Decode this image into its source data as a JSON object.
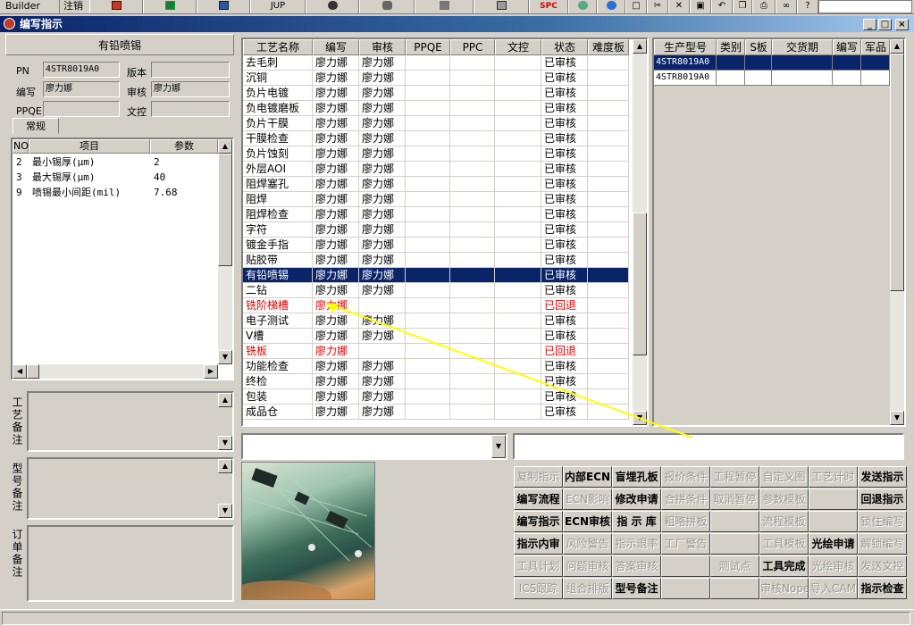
{
  "toolbar": {
    "builder_label": "Builder",
    "logout_label": "注销",
    "jup_label": "JUP",
    "spc_label": "SPC"
  },
  "window": {
    "title": "编写指示"
  },
  "left_panel": {
    "title": "有铅喷锡",
    "pn_label": "PN",
    "pn_value": "4STR8019A0",
    "version_label": "版本",
    "version_value": "",
    "writer_label": "编写",
    "writer_value": "廖力娜",
    "reviewer_label": "审核",
    "reviewer_value": "廖力娜",
    "ppqe_label": "PPQE",
    "ppqe_value": "",
    "doc_control_label": "文控",
    "doc_control_value": "",
    "tab_label": "常规",
    "param_headers": [
      "NO",
      "项目",
      "参数"
    ],
    "params": [
      {
        "no": "2",
        "item": "最小锡厚(μm)",
        "value": "2"
      },
      {
        "no": "3",
        "item": "最大锡厚(μm)",
        "value": "40"
      },
      {
        "no": "9",
        "item": "喷锡最小间距(mil)",
        "value": "7.68"
      }
    ]
  },
  "remarks": {
    "process_remark_label": "工艺备注",
    "model_remark_label": "型号备注",
    "order_remark_label": "订单备注"
  },
  "process_grid": {
    "headers": [
      "工艺名称",
      "编写",
      "审核",
      "PPQE",
      "PPC",
      "文控",
      "状态",
      "难度板"
    ],
    "selected_index": 14,
    "rows": [
      {
        "name": "去毛刺",
        "writer": "廖力娜",
        "reviewer": "廖力娜",
        "status": "已审核",
        "returned": false
      },
      {
        "name": "沉铜",
        "writer": "廖力娜",
        "reviewer": "廖力娜",
        "status": "已审核",
        "returned": false
      },
      {
        "name": "负片电镀",
        "writer": "廖力娜",
        "reviewer": "廖力娜",
        "status": "已审核",
        "returned": false
      },
      {
        "name": "负电镀磨板",
        "writer": "廖力娜",
        "reviewer": "廖力娜",
        "status": "已审核",
        "returned": false
      },
      {
        "name": "负片干膜",
        "writer": "廖力娜",
        "reviewer": "廖力娜",
        "status": "已审核",
        "returned": false
      },
      {
        "name": "干膜检查",
        "writer": "廖力娜",
        "reviewer": "廖力娜",
        "status": "已审核",
        "returned": false
      },
      {
        "name": "负片蚀刻",
        "writer": "廖力娜",
        "reviewer": "廖力娜",
        "status": "已审核",
        "returned": false
      },
      {
        "name": "外层AOI",
        "writer": "廖力娜",
        "reviewer": "廖力娜",
        "status": "已审核",
        "returned": false
      },
      {
        "name": "阻焊塞孔",
        "writer": "廖力娜",
        "reviewer": "廖力娜",
        "status": "已审核",
        "returned": false
      },
      {
        "name": "阻焊",
        "writer": "廖力娜",
        "reviewer": "廖力娜",
        "status": "已审核",
        "returned": false
      },
      {
        "name": "阻焊检查",
        "writer": "廖力娜",
        "reviewer": "廖力娜",
        "status": "已审核",
        "returned": false
      },
      {
        "name": "字符",
        "writer": "廖力娜",
        "reviewer": "廖力娜",
        "status": "已审核",
        "returned": false
      },
      {
        "name": "镀金手指",
        "writer": "廖力娜",
        "reviewer": "廖力娜",
        "status": "已审核",
        "returned": false
      },
      {
        "name": "贴胶带",
        "writer": "廖力娜",
        "reviewer": "廖力娜",
        "status": "已审核",
        "returned": false
      },
      {
        "name": "有铅喷锡",
        "writer": "廖力娜",
        "reviewer": "廖力娜",
        "status": "已审核",
        "returned": false
      },
      {
        "name": "二钻",
        "writer": "廖力娜",
        "reviewer": "廖力娜",
        "status": "已审核",
        "returned": false
      },
      {
        "name": "铣阶梯槽",
        "writer": "廖力娜",
        "reviewer": "",
        "status": "已回退",
        "returned": true
      },
      {
        "name": "电子测试",
        "writer": "廖力娜",
        "reviewer": "廖力娜",
        "status": "已审核",
        "returned": false
      },
      {
        "name": "V槽",
        "writer": "廖力娜",
        "reviewer": "廖力娜",
        "status": "已审核",
        "returned": false
      },
      {
        "name": "铣板",
        "writer": "廖力娜",
        "reviewer": "",
        "status": "已回退",
        "returned": true
      },
      {
        "name": "功能检查",
        "writer": "廖力娜",
        "reviewer": "廖力娜",
        "status": "已审核",
        "returned": false
      },
      {
        "name": "终检",
        "writer": "廖力娜",
        "reviewer": "廖力娜",
        "status": "已审核",
        "returned": false
      },
      {
        "name": "包装",
        "writer": "廖力娜",
        "reviewer": "廖力娜",
        "status": "已审核",
        "returned": false
      },
      {
        "name": "成品仓",
        "writer": "廖力娜",
        "reviewer": "廖力娜",
        "status": "已审核",
        "returned": false
      }
    ]
  },
  "model_grid": {
    "headers": [
      "生产型号",
      "类别",
      "S板",
      "交货期",
      "编写",
      "军品"
    ],
    "rows": [
      {
        "model": "4STR8019A0",
        "selected": true
      },
      {
        "model": "4STR8019A0",
        "selected": false
      }
    ]
  },
  "buttons": [
    [
      {
        "label": "复制指示",
        "enabled": false
      },
      {
        "label": "内部ECN",
        "enabled": true,
        "bold": true
      },
      {
        "label": "盲埋孔板",
        "enabled": true,
        "bold": true
      },
      {
        "label": "报价条件",
        "enabled": false
      },
      {
        "label": "工程暂停",
        "enabled": false
      },
      {
        "label": "自定义图",
        "enabled": false
      },
      {
        "label": "工艺计时",
        "enabled": false
      },
      {
        "label": "发送指示",
        "enabled": true,
        "bold": true
      }
    ],
    [
      {
        "label": "编写流程",
        "enabled": true,
        "bold": true
      },
      {
        "label": "ECN影响",
        "enabled": false
      },
      {
        "label": "修改申请",
        "enabled": true,
        "bold": true
      },
      {
        "label": "合拼条件",
        "enabled": false
      },
      {
        "label": "取消暂停",
        "enabled": false
      },
      {
        "label": "参数模板",
        "enabled": false
      },
      {
        "label": "",
        "enabled": false
      },
      {
        "label": "回退指示",
        "enabled": true,
        "bold": true
      }
    ],
    [
      {
        "label": "编写指示",
        "enabled": true,
        "bold": true
      },
      {
        "label": "ECN审核",
        "enabled": true,
        "bold": true
      },
      {
        "label": "指 示 库",
        "enabled": true,
        "bold": true
      },
      {
        "label": "粗略拼板",
        "enabled": false
      },
      {
        "label": "",
        "enabled": false
      },
      {
        "label": "流程模板",
        "enabled": false
      },
      {
        "label": "",
        "enabled": false
      },
      {
        "label": "锁住编写",
        "enabled": false
      }
    ],
    [
      {
        "label": "指示内审",
        "enabled": true,
        "bold": true
      },
      {
        "label": "风险警告",
        "enabled": false
      },
      {
        "label": "指示退率",
        "enabled": false
      },
      {
        "label": "工厂警告",
        "enabled": false
      },
      {
        "label": "",
        "enabled": false
      },
      {
        "label": "工具模板",
        "enabled": false
      },
      {
        "label": "光绘申请",
        "enabled": true,
        "bold": true
      },
      {
        "label": "解锁编写",
        "enabled": false
      }
    ],
    [
      {
        "label": "工具计划",
        "enabled": false
      },
      {
        "label": "问题审核",
        "enabled": false
      },
      {
        "label": "答案审核",
        "enabled": false
      },
      {
        "label": "",
        "enabled": false
      },
      {
        "label": "测试点",
        "enabled": false
      },
      {
        "label": "工具完成",
        "enabled": true,
        "bold": true
      },
      {
        "label": "光绘审核",
        "enabled": false
      },
      {
        "label": "发送文控",
        "enabled": false
      }
    ],
    [
      {
        "label": "ICS跟踪",
        "enabled": false
      },
      {
        "label": "组合排版",
        "enabled": false
      },
      {
        "label": "型号备注",
        "enabled": true,
        "bold": true
      },
      {
        "label": "",
        "enabled": false
      },
      {
        "label": "",
        "enabled": false
      },
      {
        "label": "审核Nope",
        "enabled": false
      },
      {
        "label": "导入CAM",
        "enabled": false
      },
      {
        "label": "指示检查",
        "enabled": true,
        "bold": true
      }
    ]
  ]
}
